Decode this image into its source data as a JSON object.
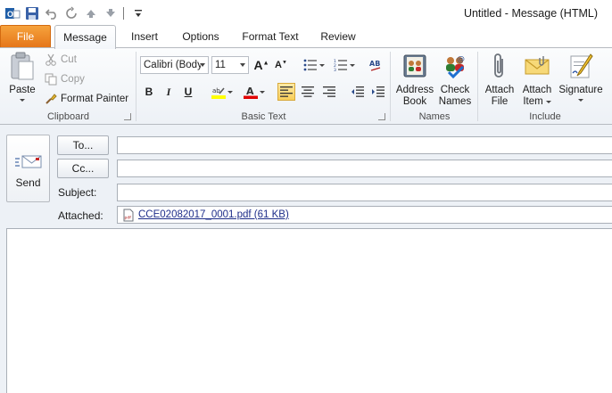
{
  "window": {
    "title": "Untitled  -  Message (HTML)"
  },
  "tabs": [
    {
      "label": "File"
    },
    {
      "label": "Message"
    },
    {
      "label": "Insert"
    },
    {
      "label": "Options"
    },
    {
      "label": "Format Text"
    },
    {
      "label": "Review"
    }
  ],
  "clipboard": {
    "paste": "Paste",
    "cut": "Cut",
    "copy": "Copy",
    "format_painter": "Format Painter",
    "group_label": "Clipboard"
  },
  "basic_text": {
    "font_name": "Calibri (Body)",
    "font_size": "11",
    "group_label": "Basic Text"
  },
  "names": {
    "address_book_1": "Address",
    "address_book_2": "Book",
    "check_names_1": "Check",
    "check_names_2": "Names",
    "group_label": "Names"
  },
  "include": {
    "attach_file_1": "Attach",
    "attach_file_2": "File",
    "attach_item_1": "Attach",
    "attach_item_2": "Item",
    "signature": "Signature",
    "group_label": "Include"
  },
  "compose": {
    "send": "Send",
    "to": "To...",
    "cc": "Cc...",
    "subject": "Subject:",
    "attached": "Attached:",
    "attachment_name": "CCE02082017_0001.pdf (61 KB)"
  },
  "colors": {
    "file_tab": "#e5761a",
    "highlight": "#ffff00",
    "font_color": "#e00000",
    "accent": "#f8cf5a"
  }
}
